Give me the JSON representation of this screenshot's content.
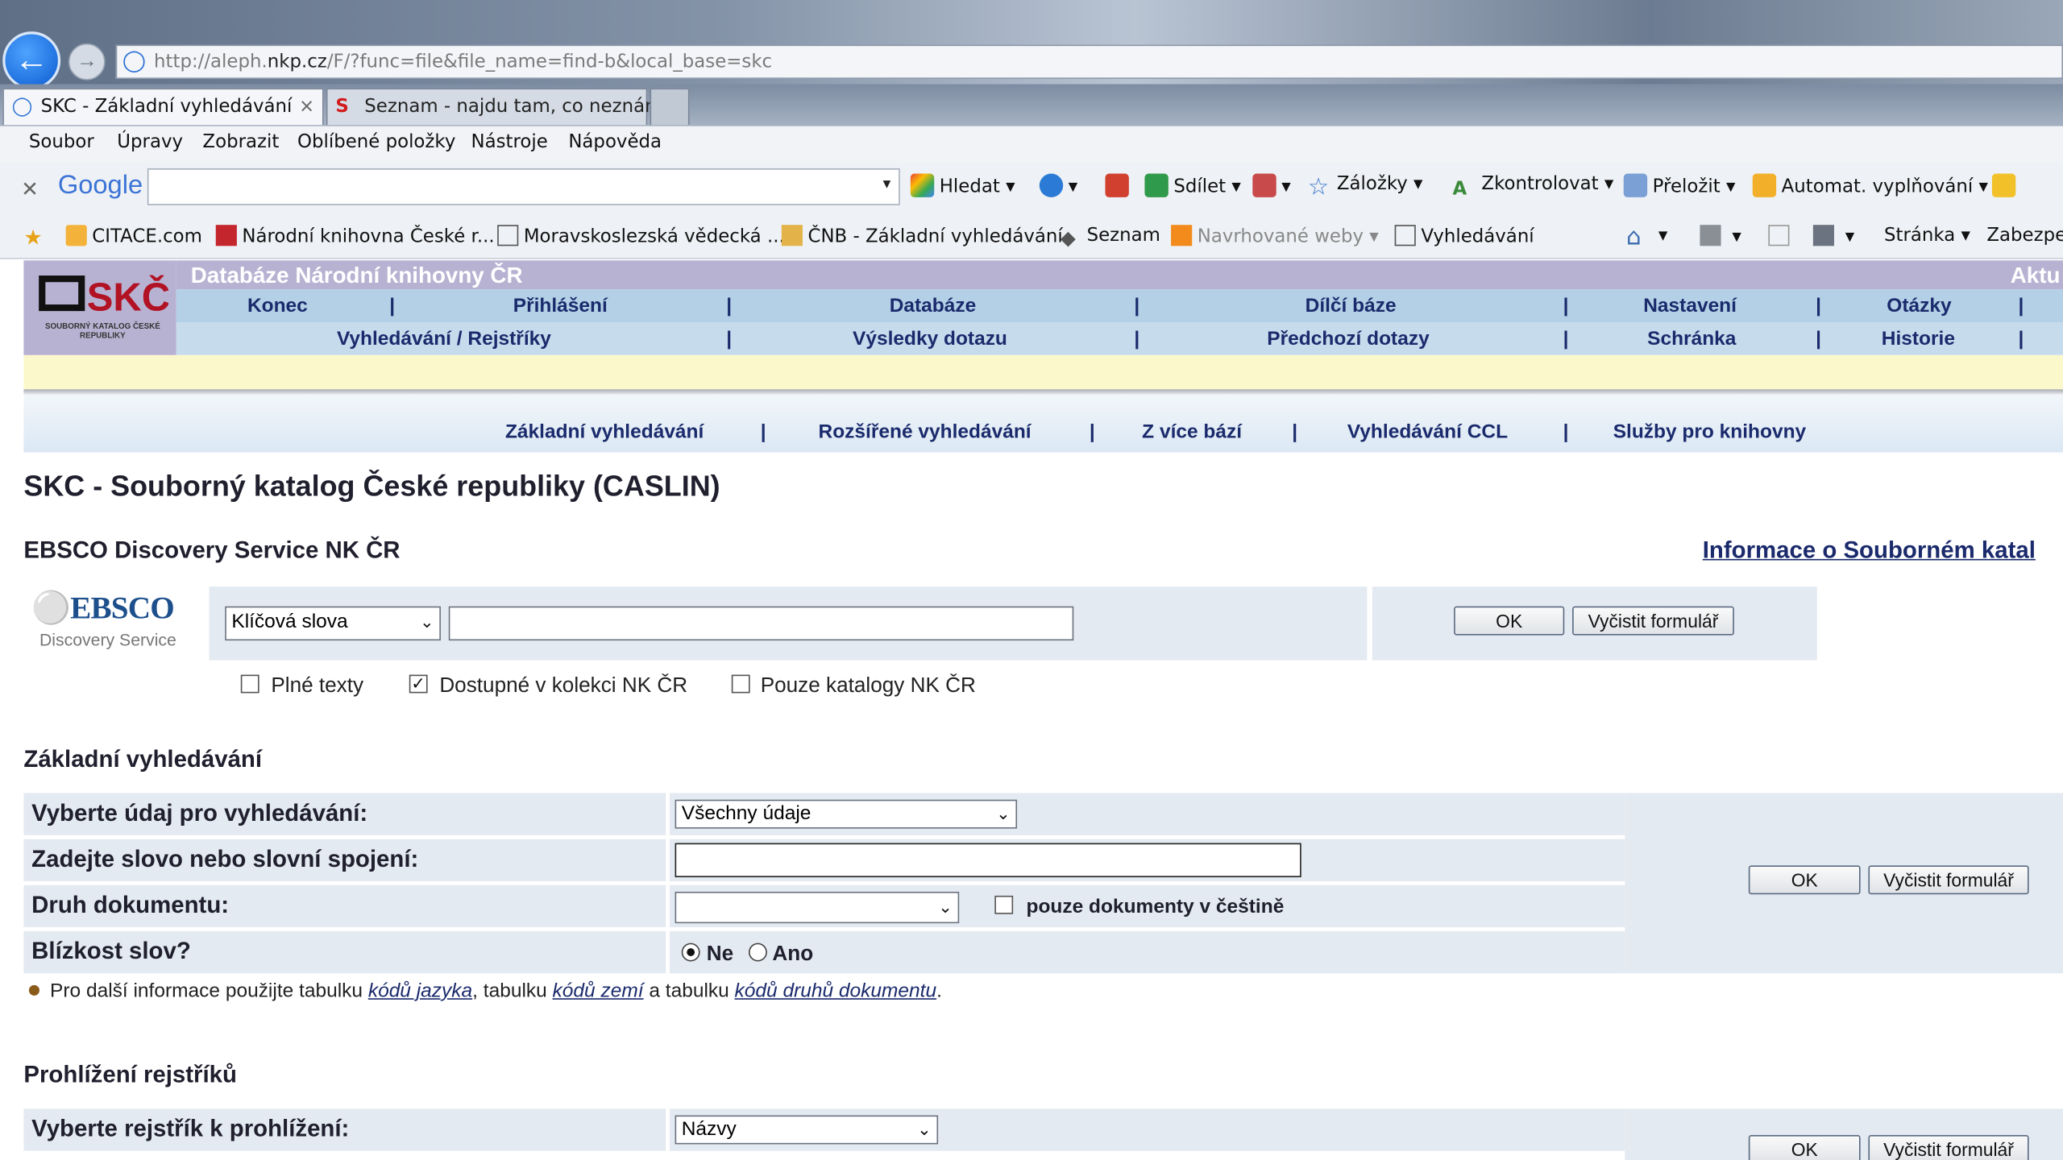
{
  "browser": {
    "address": {
      "prefix": "http://aleph.",
      "host": "nkp.cz",
      "path": "/F/?func=file&file_name=find-b&local_base=skc"
    },
    "tabs": [
      {
        "label": "SKC - Základní vyhledávání",
        "close": "×"
      },
      {
        "label": "Seznam - najdu tam, co neznám"
      }
    ],
    "menu": [
      "Soubor",
      "Úpravy",
      "Zobrazit",
      "Oblíbené položky",
      "Nástroje",
      "Nápověda"
    ],
    "google_toolbar": {
      "logo": "Google",
      "items": [
        "Hledat",
        "Sdílet",
        "Záložky",
        "Zkontrolovat",
        "Přeložit",
        "Automat. vyplňování"
      ]
    },
    "favorites": [
      "CITACE.com",
      "Národní knihovna České r...",
      "Moravskoslezská vědecká ...",
      "ČNB - Základní vyhledávání",
      "Seznam",
      "Navrhované weby",
      "Vyhledávání"
    ],
    "command_bar": {
      "page": "Stránka",
      "security": "Zabezpeč"
    }
  },
  "site": {
    "logo_text": "SKČR",
    "logo_sub": "SOUBORNÝ KATALOG ČESKÉ REPUBLIKY",
    "db_title": "Databáze Národní knihovny ČR",
    "aktu": "Aktu",
    "nav_row1": [
      "Konec",
      "Přihlášení",
      "Databáze",
      "Dílčí báze",
      "Nastavení",
      "Otázky"
    ],
    "nav_row2": [
      "Vyhledávání / Rejstříky",
      "Výsledky dotazu",
      "Předchozí dotazy",
      "Schránka",
      "Historie"
    ],
    "subnav": [
      "Základní vyhledávání",
      "Rozšířené vyhledávání",
      "Z více bází",
      "Vyhledávání CCL",
      "Služby pro knihovny"
    ],
    "separator": "|"
  },
  "page": {
    "title": "SKC - Souborný katalog České republiky (CASLIN)",
    "ebsco_heading": "EBSCO Discovery Service NK ČR",
    "info_link": "Informace o Souborném katal",
    "ebsco": {
      "logo": "EBSCO",
      "logo_tag": "Discovery Service",
      "select_value": "Klíčová slova",
      "ok": "OK",
      "clear": "Vyčistit formulář",
      "checkboxes": [
        {
          "label": "Plné texty",
          "checked": false
        },
        {
          "label": "Dostupné v kolekci NK ČR",
          "checked": true
        },
        {
          "label": "Pouze katalogy NK ČR",
          "checked": false
        }
      ]
    },
    "basic": {
      "heading": "Základní vyhledávání",
      "field_label": "Vyberte údaj pro vyhledávání:",
      "field_value": "Všechny údaje",
      "word_label": "Zadejte slovo nebo slovní spojení:",
      "doctype_label": "Druh dokumentu:",
      "czech_only": "pouze dokumenty v češtině",
      "proximity_label": "Blízkost slov?",
      "radio_no": "Ne",
      "radio_yes": "Ano",
      "ok": "OK",
      "clear": "Vyčistit formulář"
    },
    "note": {
      "t1": "Pro další informace použijte tabulku ",
      "link1": "kódů jazyka",
      "t2": ", tabulku ",
      "link2": "kódů zemí",
      "t3": " a tabulku ",
      "link3": "kódů druhů dokumentu",
      "t4": "."
    },
    "browse": {
      "heading": "Prohlížení rejstříků",
      "index_label": "Vyberte rejstřík k prohlížení:",
      "index_value": "Názvy",
      "ok": "OK",
      "clear": "Vyčistit formulář"
    }
  },
  "colors": {
    "nav_text": "#1a2a6c",
    "header_purple": "#b8b2d2",
    "nav_blue": "#b3d0e6",
    "form_bg": "#e4eaf1"
  }
}
